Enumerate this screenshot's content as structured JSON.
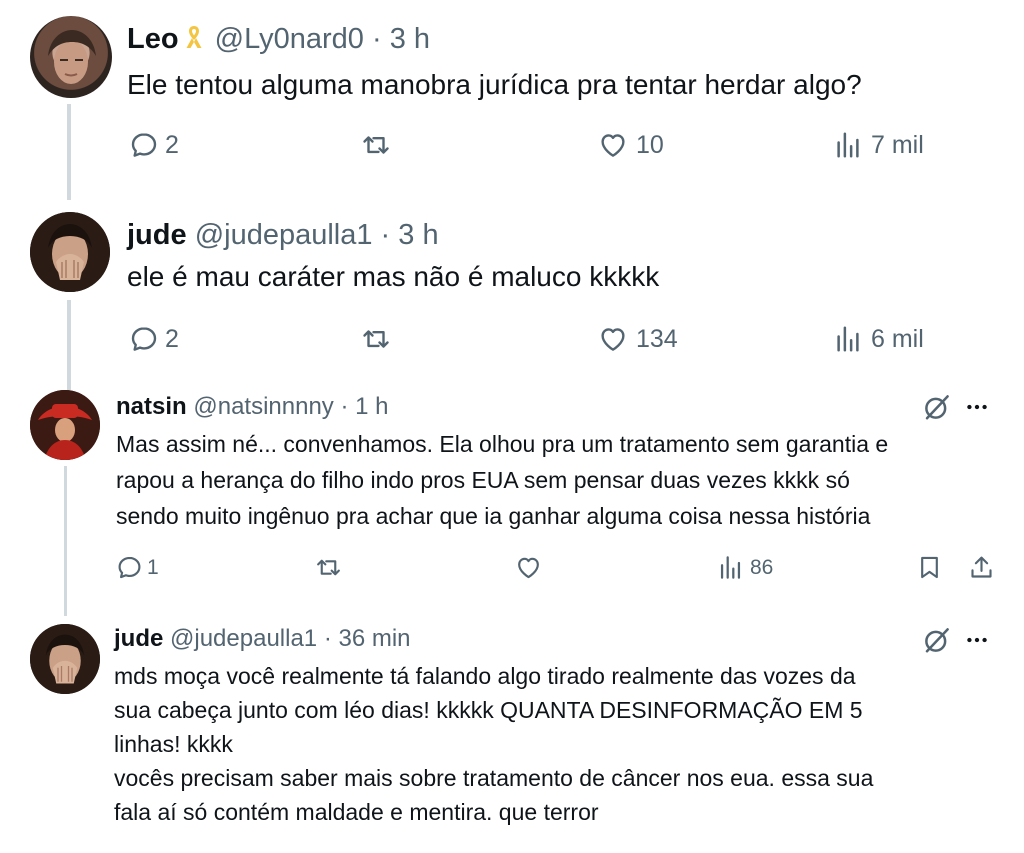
{
  "tweets": [
    {
      "name": "Leo",
      "handle": "@Ly0nard0",
      "time": "· 3 h",
      "text_lines": [
        "Ele tentou alguma manobra jurídica pra tentar herdar algo?"
      ],
      "replies": "2",
      "retweets": "",
      "likes": "10",
      "views": "7 mil",
      "avatar_icon": "profile-photo-leo",
      "badge_icon": "yellow-ribbon-icon"
    },
    {
      "name": "jude",
      "handle": "@judepaulla1",
      "time": "· 3 h",
      "text_lines": [
        "ele é mau caráter mas não é maluco kkkkk"
      ],
      "replies": "2",
      "retweets": "",
      "likes": "134",
      "views": "6 mil",
      "avatar_icon": "profile-photo-jude"
    },
    {
      "name": "natsin",
      "handle": "@natsinnnny",
      "time": "· 1 h",
      "text_lines": [
        "Mas assim né... convenhamos. Ela olhou pra um tratamento sem garantia e",
        "rapou a herança do filho indo pros EUA sem pensar duas vezes kkkk só",
        "sendo muito ingênuo pra achar que ia ganhar alguma coisa nessa história"
      ],
      "replies": "1",
      "retweets": "",
      "likes": "",
      "views": "86",
      "avatar_icon": "profile-photo-natsin"
    },
    {
      "name": "jude",
      "handle": "@judepaulla1",
      "time": "· 36 min",
      "text_lines": [
        "mds moça você realmente tá falando algo tirado realmente das vozes da",
        "sua cabeça junto com léo dias! kkkkk QUANTA DESINFORMAÇÃO EM 5",
        "linhas! kkkk",
        "vocês precisam saber mais sobre tratamento de câncer nos eua. essa sua",
        "fala aí só contém maldade e mentira. que terror"
      ],
      "avatar_icon": "profile-photo-jude"
    }
  ],
  "colors": {
    "text": "#0f1419",
    "secondary": "#536471",
    "thread_line": "#cfd9de",
    "ribbon": "#f4c542"
  },
  "icons": [
    "reply-icon",
    "retweet-icon",
    "like-icon",
    "views-icon",
    "bookmark-icon",
    "share-icon",
    "grok-icon",
    "more-icon"
  ]
}
